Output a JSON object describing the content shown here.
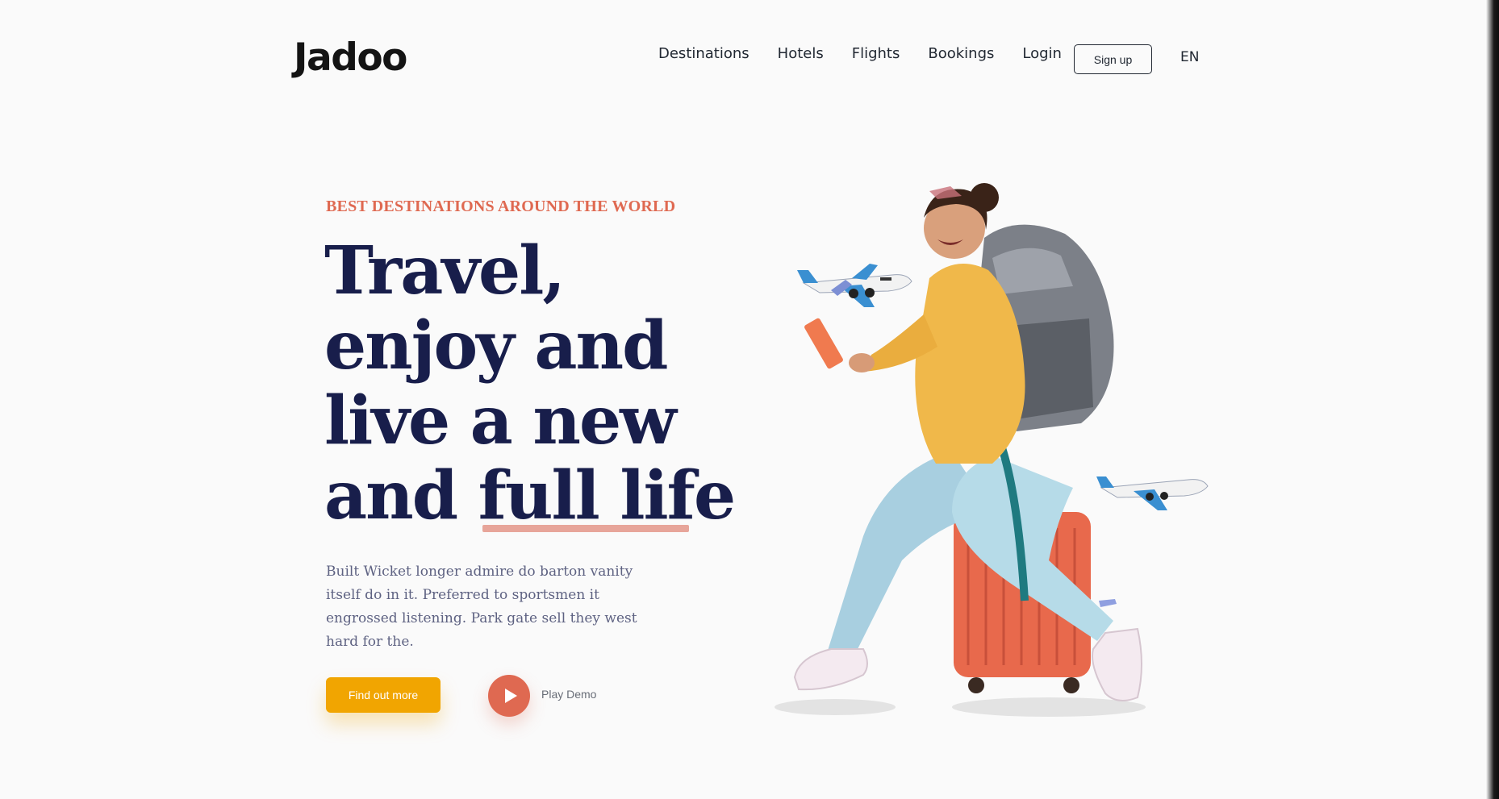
{
  "brand": {
    "logo": "Jadoo"
  },
  "nav": {
    "items": [
      "Destinations",
      "Hotels",
      "Flights",
      "Bookings",
      "Login"
    ],
    "signup": "Sign up",
    "language": "EN"
  },
  "hero": {
    "eyebrow": "BEST DESTINATIONS AROUND THE WORLD",
    "headline": {
      "line1": "Travel,",
      "line2": "enjoy and",
      "line3": "live a new",
      "line4_prefix": "and ",
      "line4_highlight": "full life"
    },
    "description": "Built Wicket longer admire do barton vanity itself do in it. Preferred to sportsmen it engrossed listening. Park gate sell they west hard for the.",
    "cta_label": "Find out more",
    "play_label": "Play Demo"
  },
  "colors": {
    "accent": "#df6951",
    "cta": "#f1a501",
    "heading": "#181e4b",
    "body": "#5e6282",
    "background": "#fafafa"
  },
  "icons": {
    "play": "play-icon",
    "illustration": "traveler-illustration"
  }
}
